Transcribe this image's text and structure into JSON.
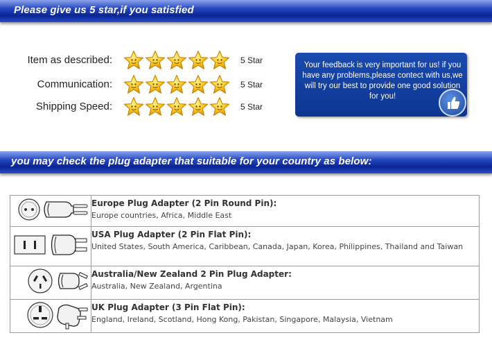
{
  "banner_top": {
    "text": "Please give us 5 star,if you satisfied"
  },
  "ratings": [
    {
      "label": "Item as described:",
      "stars": 5,
      "value": "5 Star"
    },
    {
      "label": "Communication:",
      "stars": 5,
      "value": "5 Star"
    },
    {
      "label": "Shipping Speed:",
      "stars": 5,
      "value": "5 Star"
    }
  ],
  "feedback": {
    "text": "Your feedback is very important for us! if you have any problems,please contect with us,we will  try our best to provide one good solution for you!",
    "icon": "thumbs-up-icon"
  },
  "banner_plug": {
    "text": "you may check the plug adapter that suitable for your country as below:"
  },
  "plugs": [
    {
      "title": "Europe Plug Adapter (2 Pin Round Pin):",
      "countries": "Europe countries, Africa, Middle East",
      "icon": "europe-plug-icon"
    },
    {
      "title": "USA Plug Adapter (2 Pin Flat Pin):",
      "countries": "United States, South America, Caribbean, Canada, Japan, Korea, Philippines, Thailand and Taiwan",
      "icon": "usa-plug-icon"
    },
    {
      "title": "Australia/New Zealand 2 Pin Plug Adapter:",
      "countries": "Australia, New Zealand, Argentina",
      "icon": "australia-plug-icon"
    },
    {
      "title": "UK Plug Adapter (3 Pin Flat Pin):",
      "countries": "England, Ireland, Scotland, Hong Kong, Pakistan, Singapore, Malaysia, Vietnam",
      "icon": "uk-plug-icon"
    }
  ],
  "colors": {
    "banner_blue": "#1f3fb8",
    "star_yellow": "#f5c518",
    "feedback_blue": "#0c3590"
  }
}
